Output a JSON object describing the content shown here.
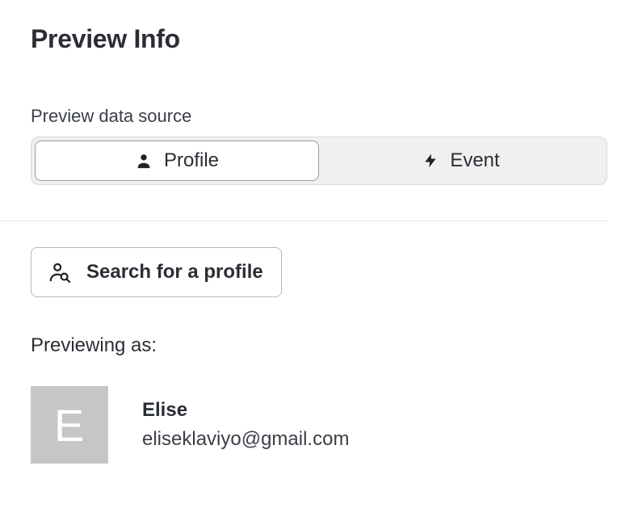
{
  "header": {
    "title": "Preview Info"
  },
  "dataSource": {
    "label": "Preview data source",
    "options": {
      "profile": "Profile",
      "event": "Event"
    },
    "selected": "profile"
  },
  "search": {
    "button_label": "Search for a profile"
  },
  "previewing": {
    "label": "Previewing as:",
    "profile": {
      "initial": "E",
      "name": "Elise",
      "email": "eliseklaviyo@gmail.com"
    }
  }
}
